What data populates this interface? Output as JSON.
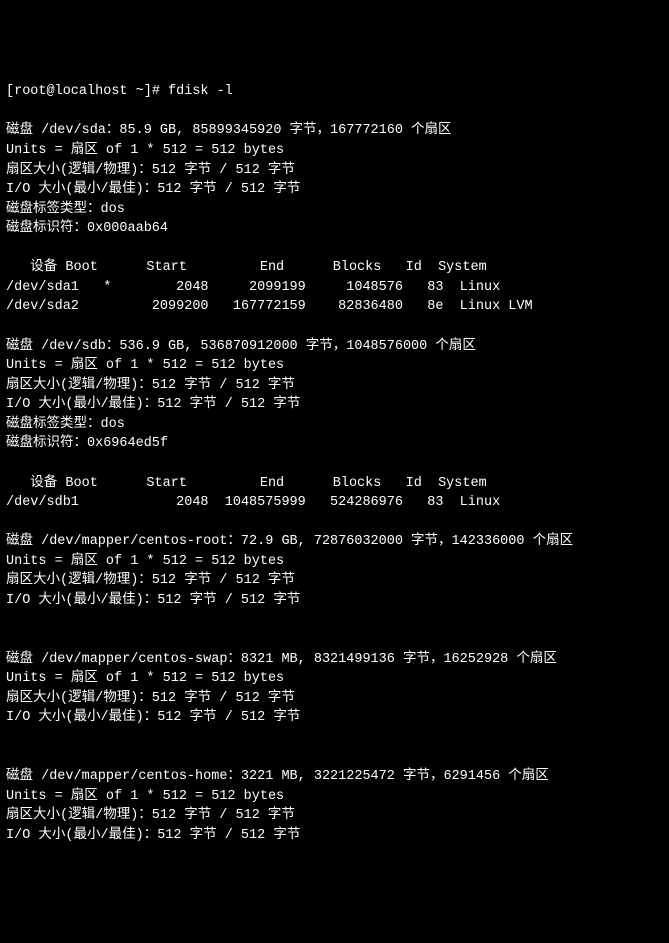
{
  "prompt": "[root@localhost ~]# ",
  "command": "fdisk -l",
  "blank": "",
  "sda": {
    "header": "磁盘 /dev/sda：85.9 GB, 85899345920 字节，167772160 个扇区",
    "units": "Units = 扇区 of 1 * 512 = 512 bytes",
    "sector": "扇区大小(逻辑/物理)：512 字节 / 512 字节",
    "io": "I/O 大小(最小/最佳)：512 字节 / 512 字节",
    "labeltype": "磁盘标签类型：dos",
    "identifier": "磁盘标识符：0x000aab64",
    "tblhdr": "   设备 Boot      Start         End      Blocks   Id  System",
    "row1": "/dev/sda1   *        2048     2099199     1048576   83  Linux",
    "row2": "/dev/sda2         2099200   167772159    82836480   8e  Linux LVM"
  },
  "sdb": {
    "header": "磁盘 /dev/sdb：536.9 GB, 536870912000 字节，1048576000 个扇区",
    "units": "Units = 扇区 of 1 * 512 = 512 bytes",
    "sector": "扇区大小(逻辑/物理)：512 字节 / 512 字节",
    "io": "I/O 大小(最小/最佳)：512 字节 / 512 字节",
    "labeltype": "磁盘标签类型：dos",
    "identifier": "磁盘标识符：0x6964ed5f",
    "tblhdr": "   设备 Boot      Start         End      Blocks   Id  System",
    "row1": "/dev/sdb1            2048  1048575999   524286976   83  Linux"
  },
  "root": {
    "header": "磁盘 /dev/mapper/centos-root：72.9 GB, 72876032000 字节，142336000 个扇区",
    "units": "Units = 扇区 of 1 * 512 = 512 bytes",
    "sector": "扇区大小(逻辑/物理)：512 字节 / 512 字节",
    "io": "I/O 大小(最小/最佳)：512 字节 / 512 字节"
  },
  "swap": {
    "header": "磁盘 /dev/mapper/centos-swap：8321 MB, 8321499136 字节，16252928 个扇区",
    "units": "Units = 扇区 of 1 * 512 = 512 bytes",
    "sector": "扇区大小(逻辑/物理)：512 字节 / 512 字节",
    "io": "I/O 大小(最小/最佳)：512 字节 / 512 字节"
  },
  "home": {
    "header": "磁盘 /dev/mapper/centos-home：3221 MB, 3221225472 字节，6291456 个扇区",
    "units": "Units = 扇区 of 1 * 512 = 512 bytes",
    "sector": "扇区大小(逻辑/物理)：512 字节 / 512 字节",
    "io": "I/O 大小(最小/最佳)：512 字节 / 512 字节"
  }
}
